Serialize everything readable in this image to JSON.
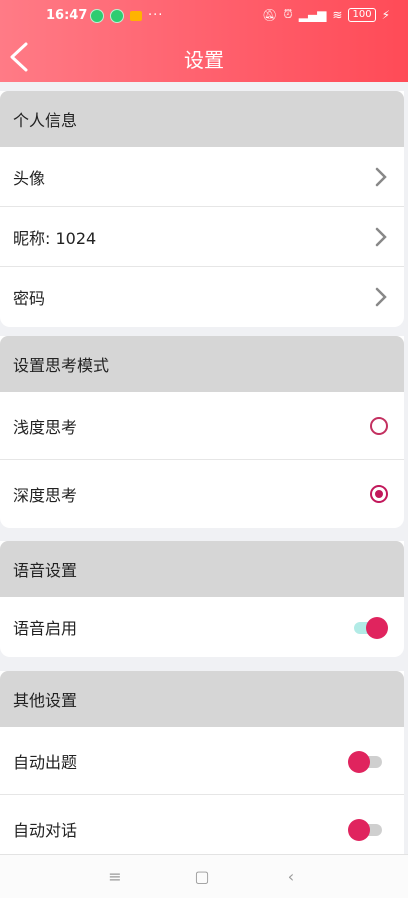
{
  "status": {
    "time": "16:47",
    "battery": "100"
  },
  "header": {
    "title": "设置"
  },
  "sections": [
    {
      "title": "个人信息",
      "rows": [
        {
          "label": "头像"
        },
        {
          "label": "昵称: 1024"
        },
        {
          "label": "密码"
        }
      ]
    },
    {
      "title": "设置思考模式",
      "rows": [
        {
          "label": "浅度思考",
          "selected": false
        },
        {
          "label": "深度思考",
          "selected": true
        }
      ]
    },
    {
      "title": "语音设置",
      "rows": [
        {
          "label": "语音启用",
          "enabled": true
        }
      ]
    },
    {
      "title": "其他设置",
      "rows": [
        {
          "label": "自动出题",
          "enabled": false
        },
        {
          "label": "自动对话",
          "enabled": false
        }
      ]
    }
  ],
  "colors": {
    "accent": "#ff5f6c",
    "toggle_thumb": "#e0245e",
    "radio": "#c2185b"
  }
}
